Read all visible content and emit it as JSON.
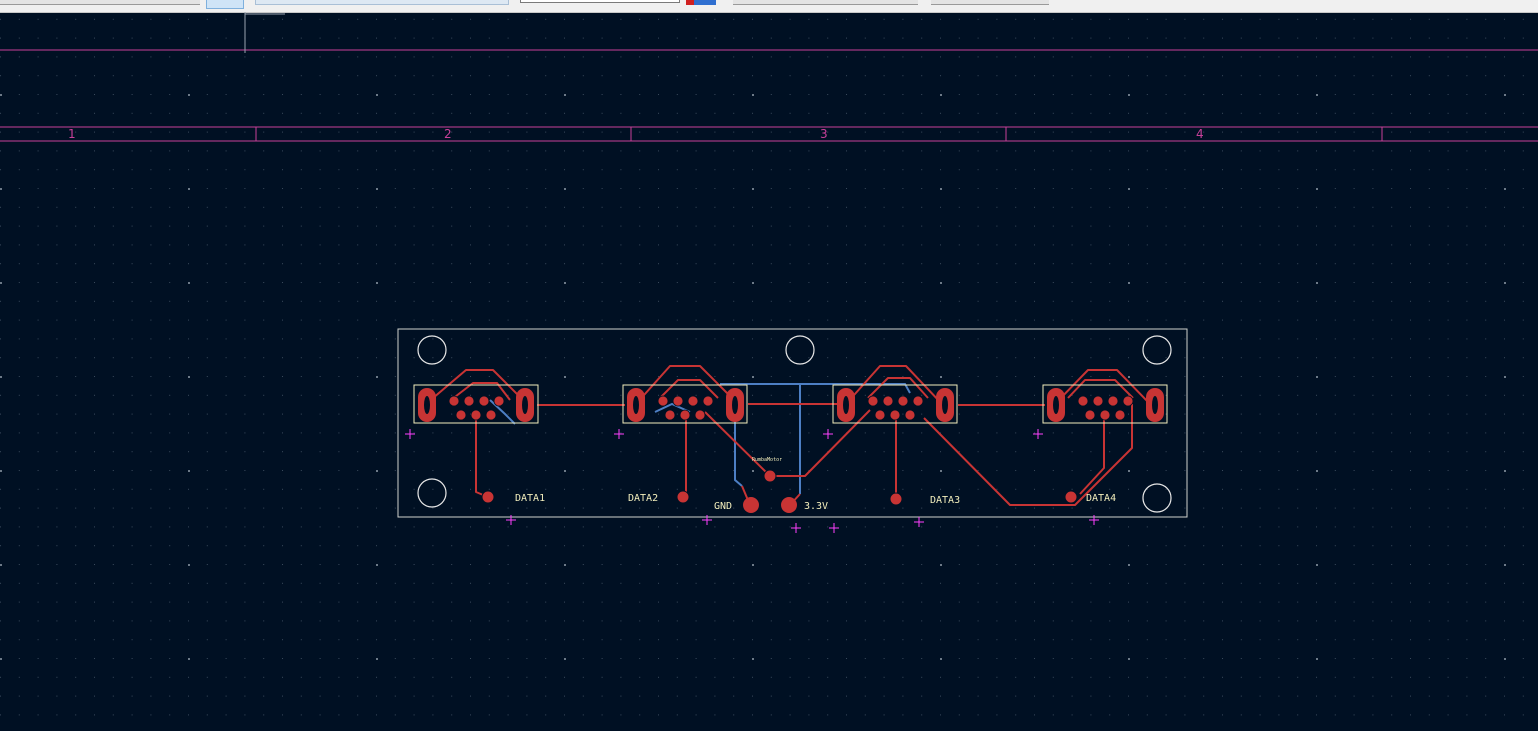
{
  "toolbar": {
    "layer_select": "",
    "value_input": ""
  },
  "sheet": {
    "zones": [
      "1",
      "2",
      "3",
      "4"
    ]
  },
  "board": {
    "labels": {
      "data1": "DATA1",
      "data2": "DATA2",
      "data3": "DATA3",
      "data4": "DATA4",
      "gnd": "GND",
      "v33": "3.3V",
      "ref": "RumbaMotor"
    }
  },
  "colors": {
    "background": "#001023",
    "front_copper": "#c83434",
    "back_copper": "#4d7fc4",
    "edge_cuts": "#d0d2cd",
    "silkscreen": "#f2eebc",
    "drawing_sheet": "#c8409a",
    "crosshair": "#ff40ff"
  }
}
